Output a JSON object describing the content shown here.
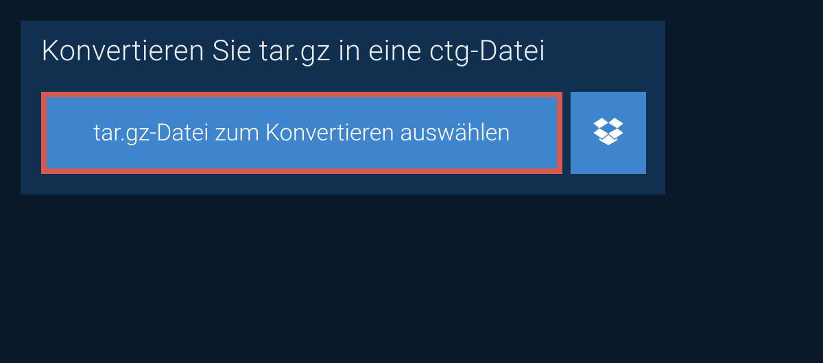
{
  "heading": "Konvertieren Sie tar.gz in eine ctg-Datei",
  "buttons": {
    "selectFile": "tar.gz-Datei zum Konvertieren auswählen"
  },
  "colors": {
    "pageBackground": "#0a1929",
    "panelBackground": "#11304f",
    "buttonBackground": "#3e85ce",
    "highlightBorder": "#d65a50",
    "text": "#e8eef3",
    "buttonText": "#ffffff"
  }
}
